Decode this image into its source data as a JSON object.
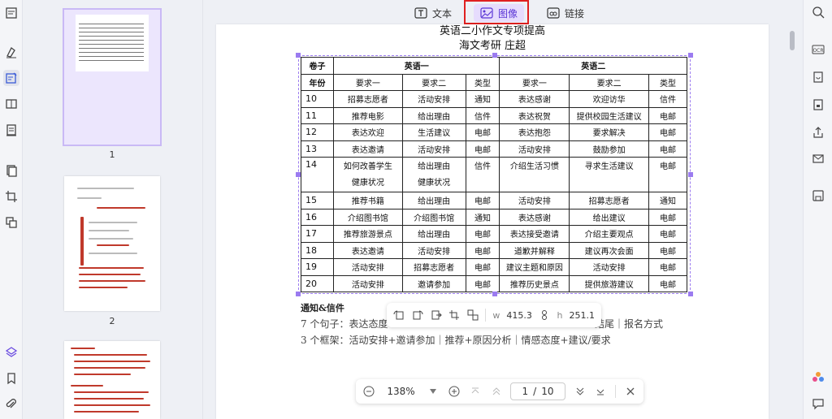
{
  "toolbar": {
    "tabs": [
      {
        "label": "文本",
        "icon": "text-icon"
      },
      {
        "label": "图像",
        "icon": "image-icon",
        "active": true
      },
      {
        "label": "链接",
        "icon": "link-icon"
      }
    ]
  },
  "thumbnails": [
    {
      "page": "1",
      "selected": true
    },
    {
      "page": "2"
    },
    {
      "page": ""
    }
  ],
  "document": {
    "heading_partial": "英语二小作文专项提高",
    "subheading": "海文考研 庄超",
    "table": {
      "group_header": {
        "col0": "卷子",
        "english1": "英语一",
        "english2": "英语二"
      },
      "sub_header": [
        "年份",
        "要求一",
        "要求二",
        "类型",
        "要求一",
        "要求二",
        "类型"
      ],
      "rows": [
        {
          "year": "10",
          "c": [
            "招募志愿者",
            "活动安排",
            "通知",
            "表达感谢",
            "欢迎访华",
            "信件"
          ]
        },
        {
          "year": "11",
          "c": [
            "推荐电影",
            "给出理由",
            "信件",
            "表达祝贺",
            "提供校园生活建议",
            "电邮"
          ]
        },
        {
          "year": "12",
          "c": [
            "表达欢迎",
            "生活建议",
            "电邮",
            "表达抱怨",
            "要求解决",
            "电邮"
          ]
        },
        {
          "year": "13",
          "c": [
            "表达邀请",
            "活动安排",
            "电邮",
            "活动安排",
            "鼓励参加",
            "电邮"
          ]
        },
        {
          "year": "14",
          "c": [
            "如何改善学生\n健康状况",
            "给出理由\n健康状况",
            "信件",
            "介绍生活习惯",
            "寻求生活建议",
            "电邮"
          ]
        },
        {
          "year": "15",
          "c": [
            "推荐书籍",
            "给出理由",
            "电邮",
            "活动安排",
            "招募志愿者",
            "通知"
          ]
        },
        {
          "year": "16",
          "c": [
            "介绍图书馆",
            "介绍图书馆",
            "通知",
            "表达感谢",
            "给出建议",
            "电邮"
          ]
        },
        {
          "year": "17",
          "c": [
            "推荐旅游景点",
            "给出理由",
            "电邮",
            "表达接受邀请",
            "介绍主要观点",
            "电邮"
          ]
        },
        {
          "year": "18",
          "c": [
            "表达邀请",
            "活动安排",
            "电邮",
            "道歉并解释",
            "建议再次会面",
            "电邮"
          ]
        },
        {
          "year": "19",
          "c": [
            "活动安排",
            "招募志愿者",
            "电邮",
            "建议主题和原因",
            "活动安排",
            "电邮"
          ]
        },
        {
          "year": "20",
          "c": [
            "活动安排",
            "邀请参加",
            "电邮",
            "推荐历史景点",
            "提供旅游建议",
            "电邮"
          ]
        }
      ]
    },
    "notes": {
      "title": "通知&信件",
      "line1": "7 个句子：表达态度",
      "line1_tail": "结尾｜报名方式",
      "line2": "3 个框架：活动安排+邀请参加｜推荐+原因分析｜情感态度+建议/要求"
    }
  },
  "image_toolbar": {
    "width_label": "w",
    "width_value": "415.3",
    "height_label": "h",
    "height_value": "251.1"
  },
  "pager": {
    "zoom": "138%",
    "current_page": "1",
    "separator": "/",
    "total_pages": "10"
  },
  "colors": {
    "accent": "#5b36d6",
    "selection": "#9b7bf0",
    "highlight_box": "#e02020"
  }
}
